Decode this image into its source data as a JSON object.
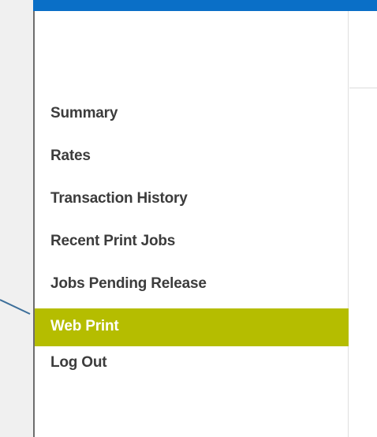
{
  "header": {
    "accent_color": "#0a6fc7"
  },
  "nav": {
    "items": [
      {
        "label": "Summary",
        "active": false
      },
      {
        "label": "Rates",
        "active": false
      },
      {
        "label": "Transaction History",
        "active": false
      },
      {
        "label": "Recent Print Jobs",
        "active": false
      },
      {
        "label": "Jobs Pending Release",
        "active": false
      },
      {
        "label": "Web Print",
        "active": true
      },
      {
        "label": "Log Out",
        "active": false
      }
    ],
    "active_color": "#b5bd00"
  }
}
